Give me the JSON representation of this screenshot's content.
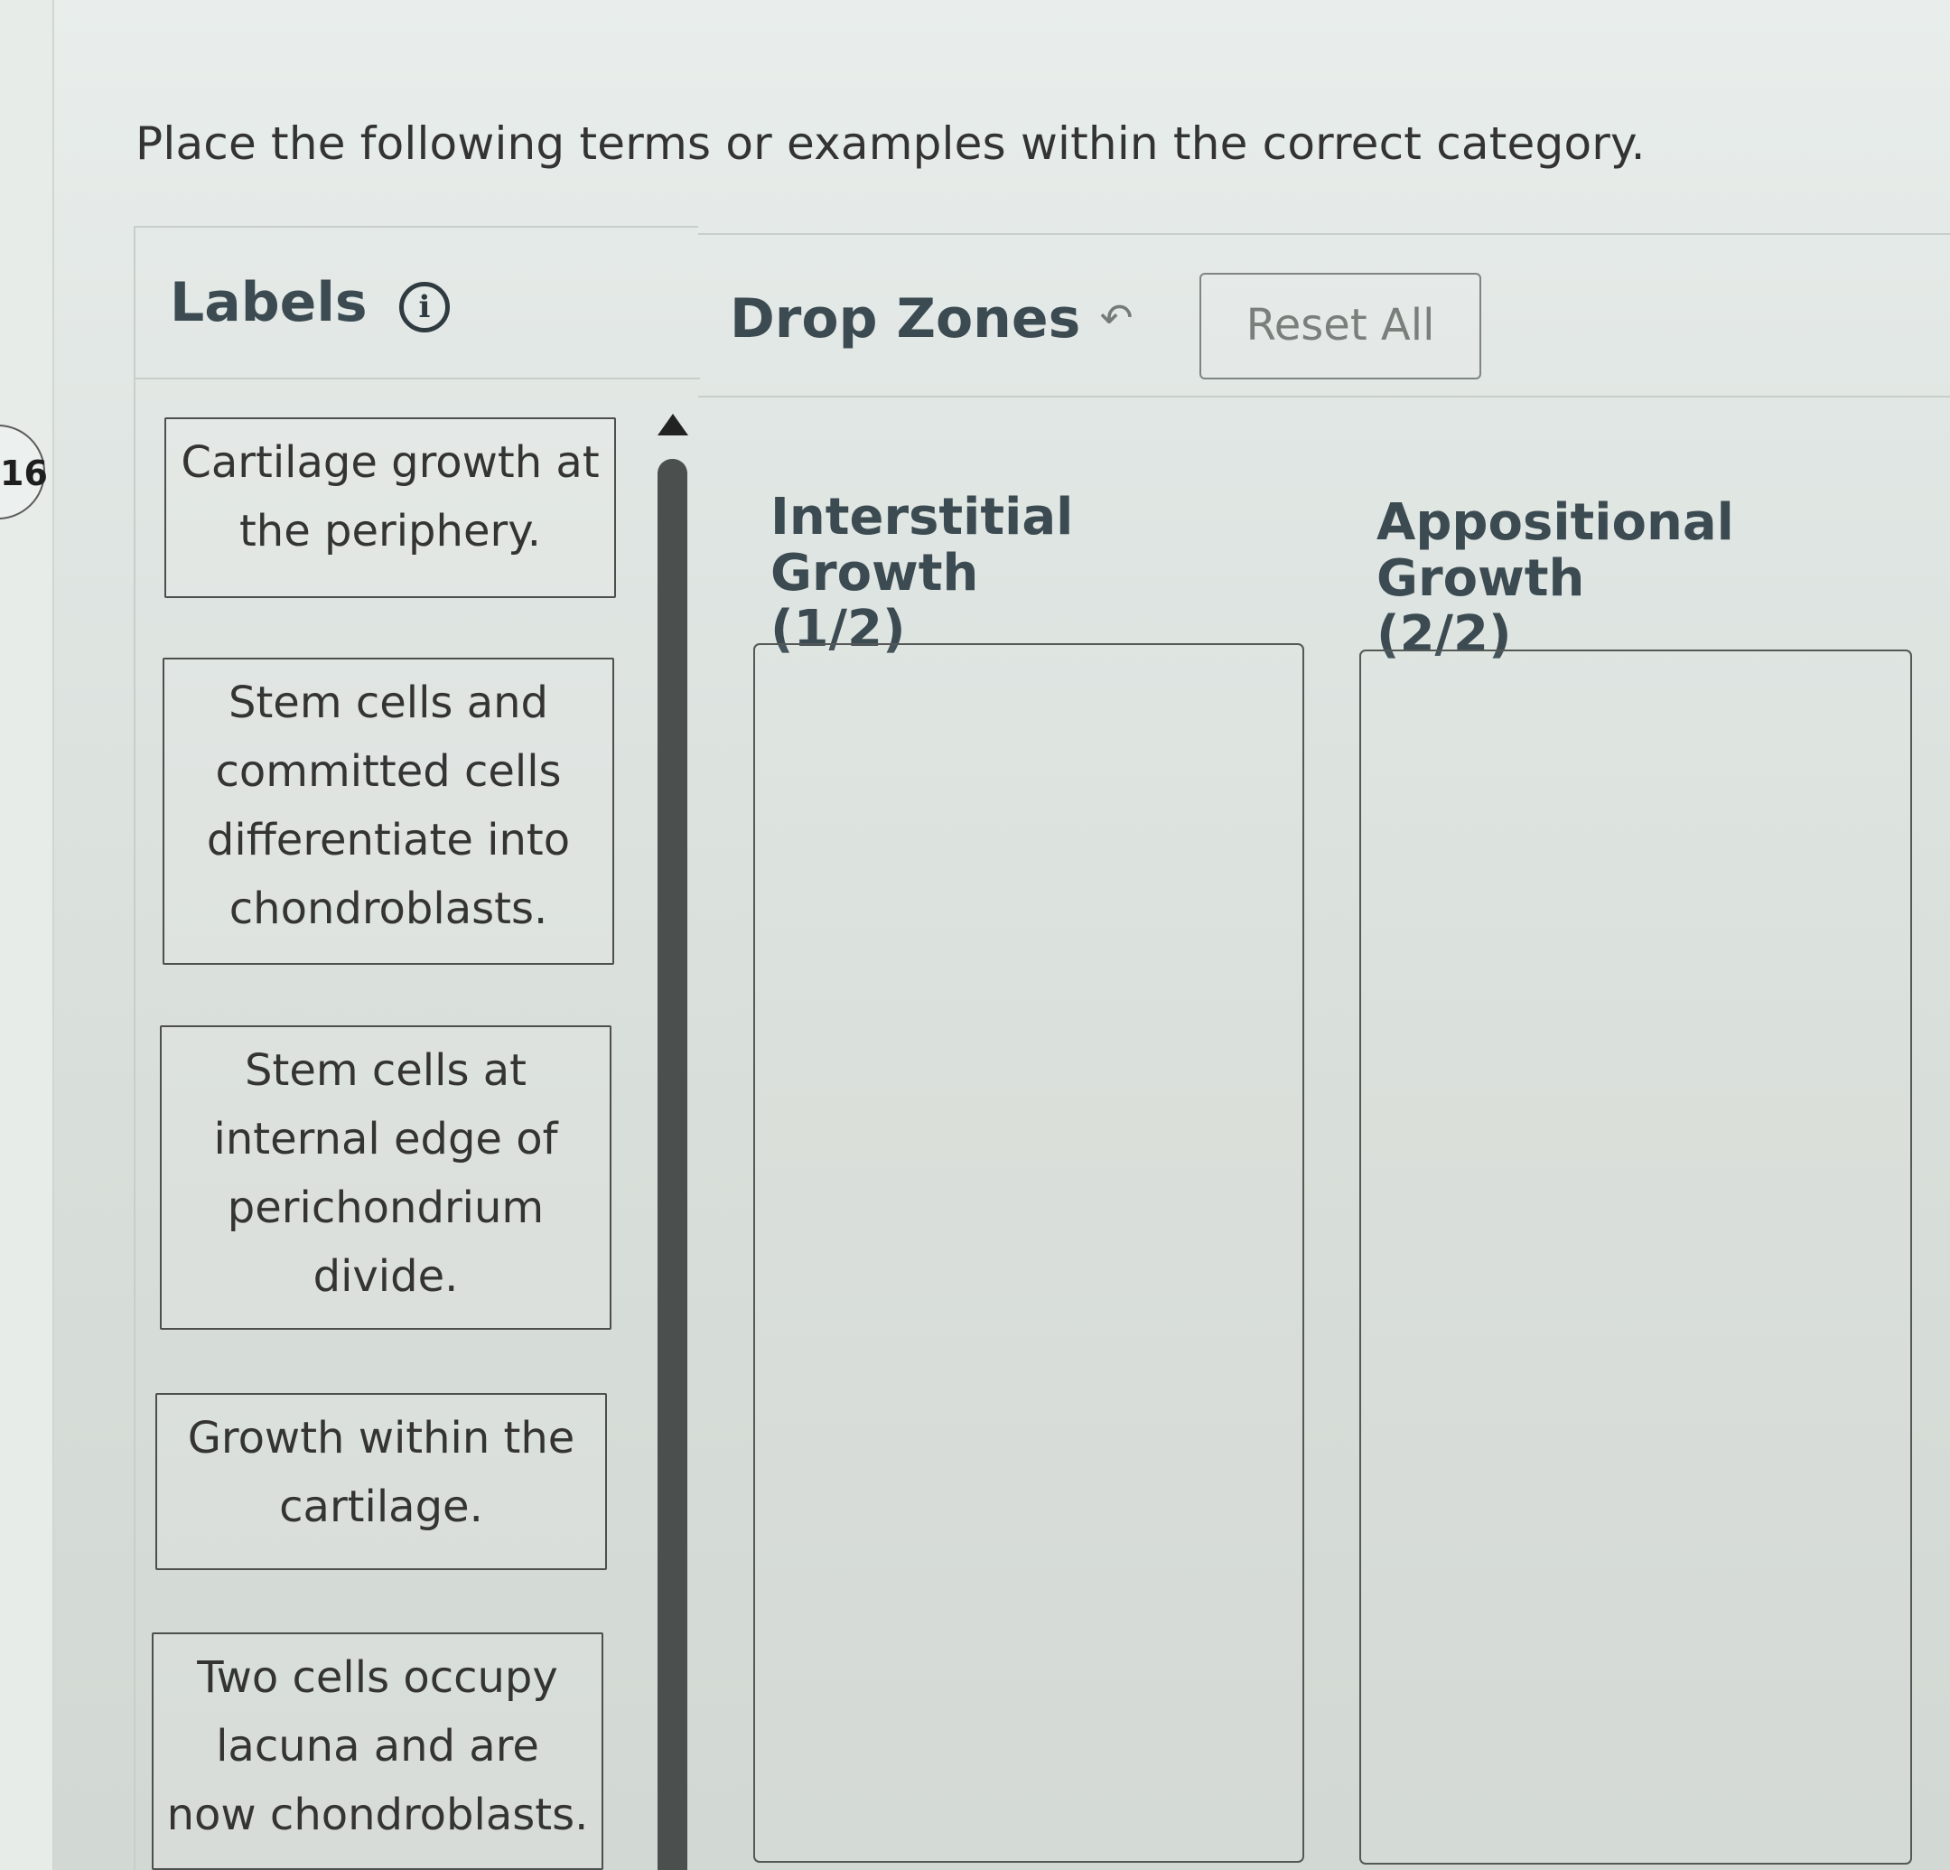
{
  "question": {
    "number_partial": "16",
    "instruction": "Place the following terms or examples within the correct category."
  },
  "labels_panel": {
    "title": "Labels",
    "info_icon": "info-icon",
    "items": [
      {
        "text": "Cartilage growth at the periphery."
      },
      {
        "text": "Stem cells and committed cells differentiate into chondroblasts."
      },
      {
        "text": "Stem cells at internal edge of perichondrium divide."
      },
      {
        "text": "Growth within the cartilage."
      },
      {
        "text": "Two cells occupy lacuna and are now chondroblasts."
      }
    ]
  },
  "drop_panel": {
    "title": "Drop Zones",
    "undo_icon": "undo-arrow-icon",
    "reset_label": "Reset All",
    "zones": [
      {
        "title": "Interstitial Growth",
        "count": "(1/2)"
      },
      {
        "title": "Appositional Growth",
        "count": "(2/2)"
      }
    ]
  }
}
